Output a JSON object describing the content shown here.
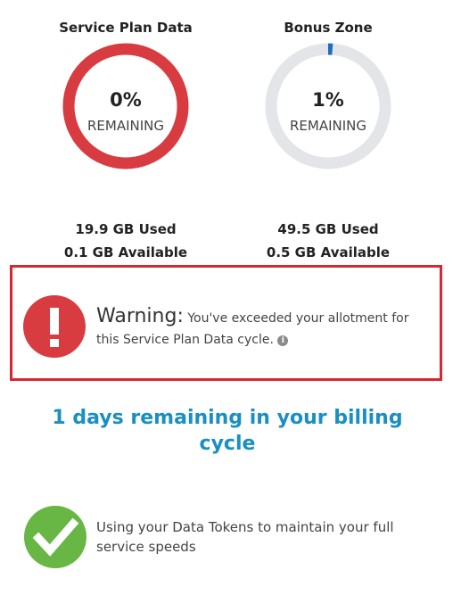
{
  "service_plan": {
    "title": "Service Plan Data",
    "percent_text": "0%",
    "percent_value": 0,
    "remaining_label": "REMAINING",
    "used": "19.9 GB Used",
    "available": "0.1 GB Available",
    "ring_color": "#d83b40"
  },
  "bonus_zone": {
    "title": "Bonus Zone",
    "percent_text": "1%",
    "percent_value": 1,
    "remaining_label": "REMAINING",
    "used": "49.5 GB Used",
    "available": "0.5 GB Available",
    "ring_track_color": "#e3e5e8",
    "ring_fill_color": "#1a6fbf"
  },
  "warning": {
    "label": "Warning:",
    "message": "You've exceeded your allotment for this Service Plan Data cycle.",
    "icon": "exclamation-icon",
    "info_icon": "info-icon",
    "border_color": "#d9262f",
    "icon_color": "#d83b40"
  },
  "billing": {
    "text": "1 days remaining in your billing cycle",
    "color": "#1a8fc1"
  },
  "tokens": {
    "icon": "checkmark-icon",
    "text": "Using your Data Tokens to maintain your full service speeds",
    "icon_color": "#68b644"
  }
}
